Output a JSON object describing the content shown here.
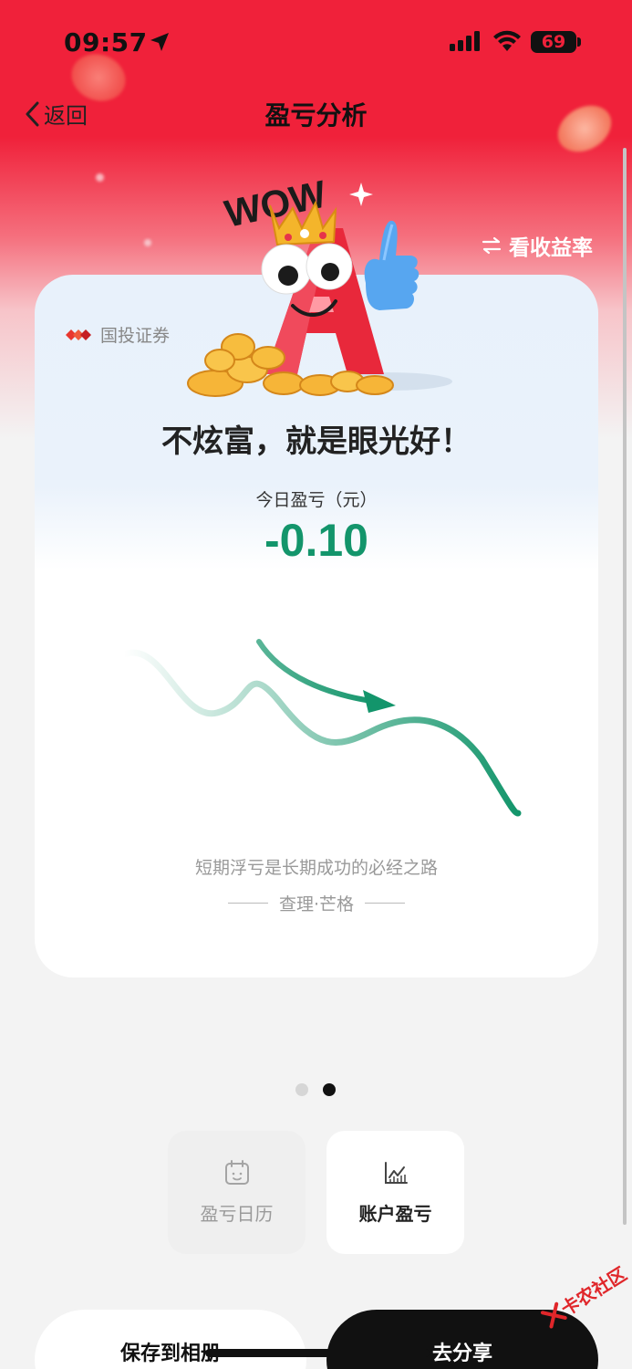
{
  "status_bar": {
    "time": "09:57",
    "battery": "69"
  },
  "nav": {
    "back_label": "返回",
    "title": "盈亏分析"
  },
  "switch_rate_label": "看收益率",
  "card": {
    "brand": "国投证券",
    "wow_text": "WOW",
    "slogan": "不炫富，就是眼光好！",
    "pnl_label": "今日盈亏（元）",
    "pnl_value": "-0.10",
    "quote": "短期浮亏是长期成功的必经之路",
    "author": "查理·芒格"
  },
  "pager": {
    "count": 2,
    "active_index": 1
  },
  "tiles": [
    {
      "label": "盈亏日历",
      "icon": "calendar-icon",
      "active": false
    },
    {
      "label": "账户盈亏",
      "icon": "chart-icon",
      "active": true
    }
  ],
  "buttons": {
    "save_label": "保存到相册",
    "share_label": "去分享"
  },
  "watermark": "卡农社区",
  "colors": {
    "brand_red": "#f0213a",
    "loss_green": "#13956b",
    "dark": "#111111"
  }
}
